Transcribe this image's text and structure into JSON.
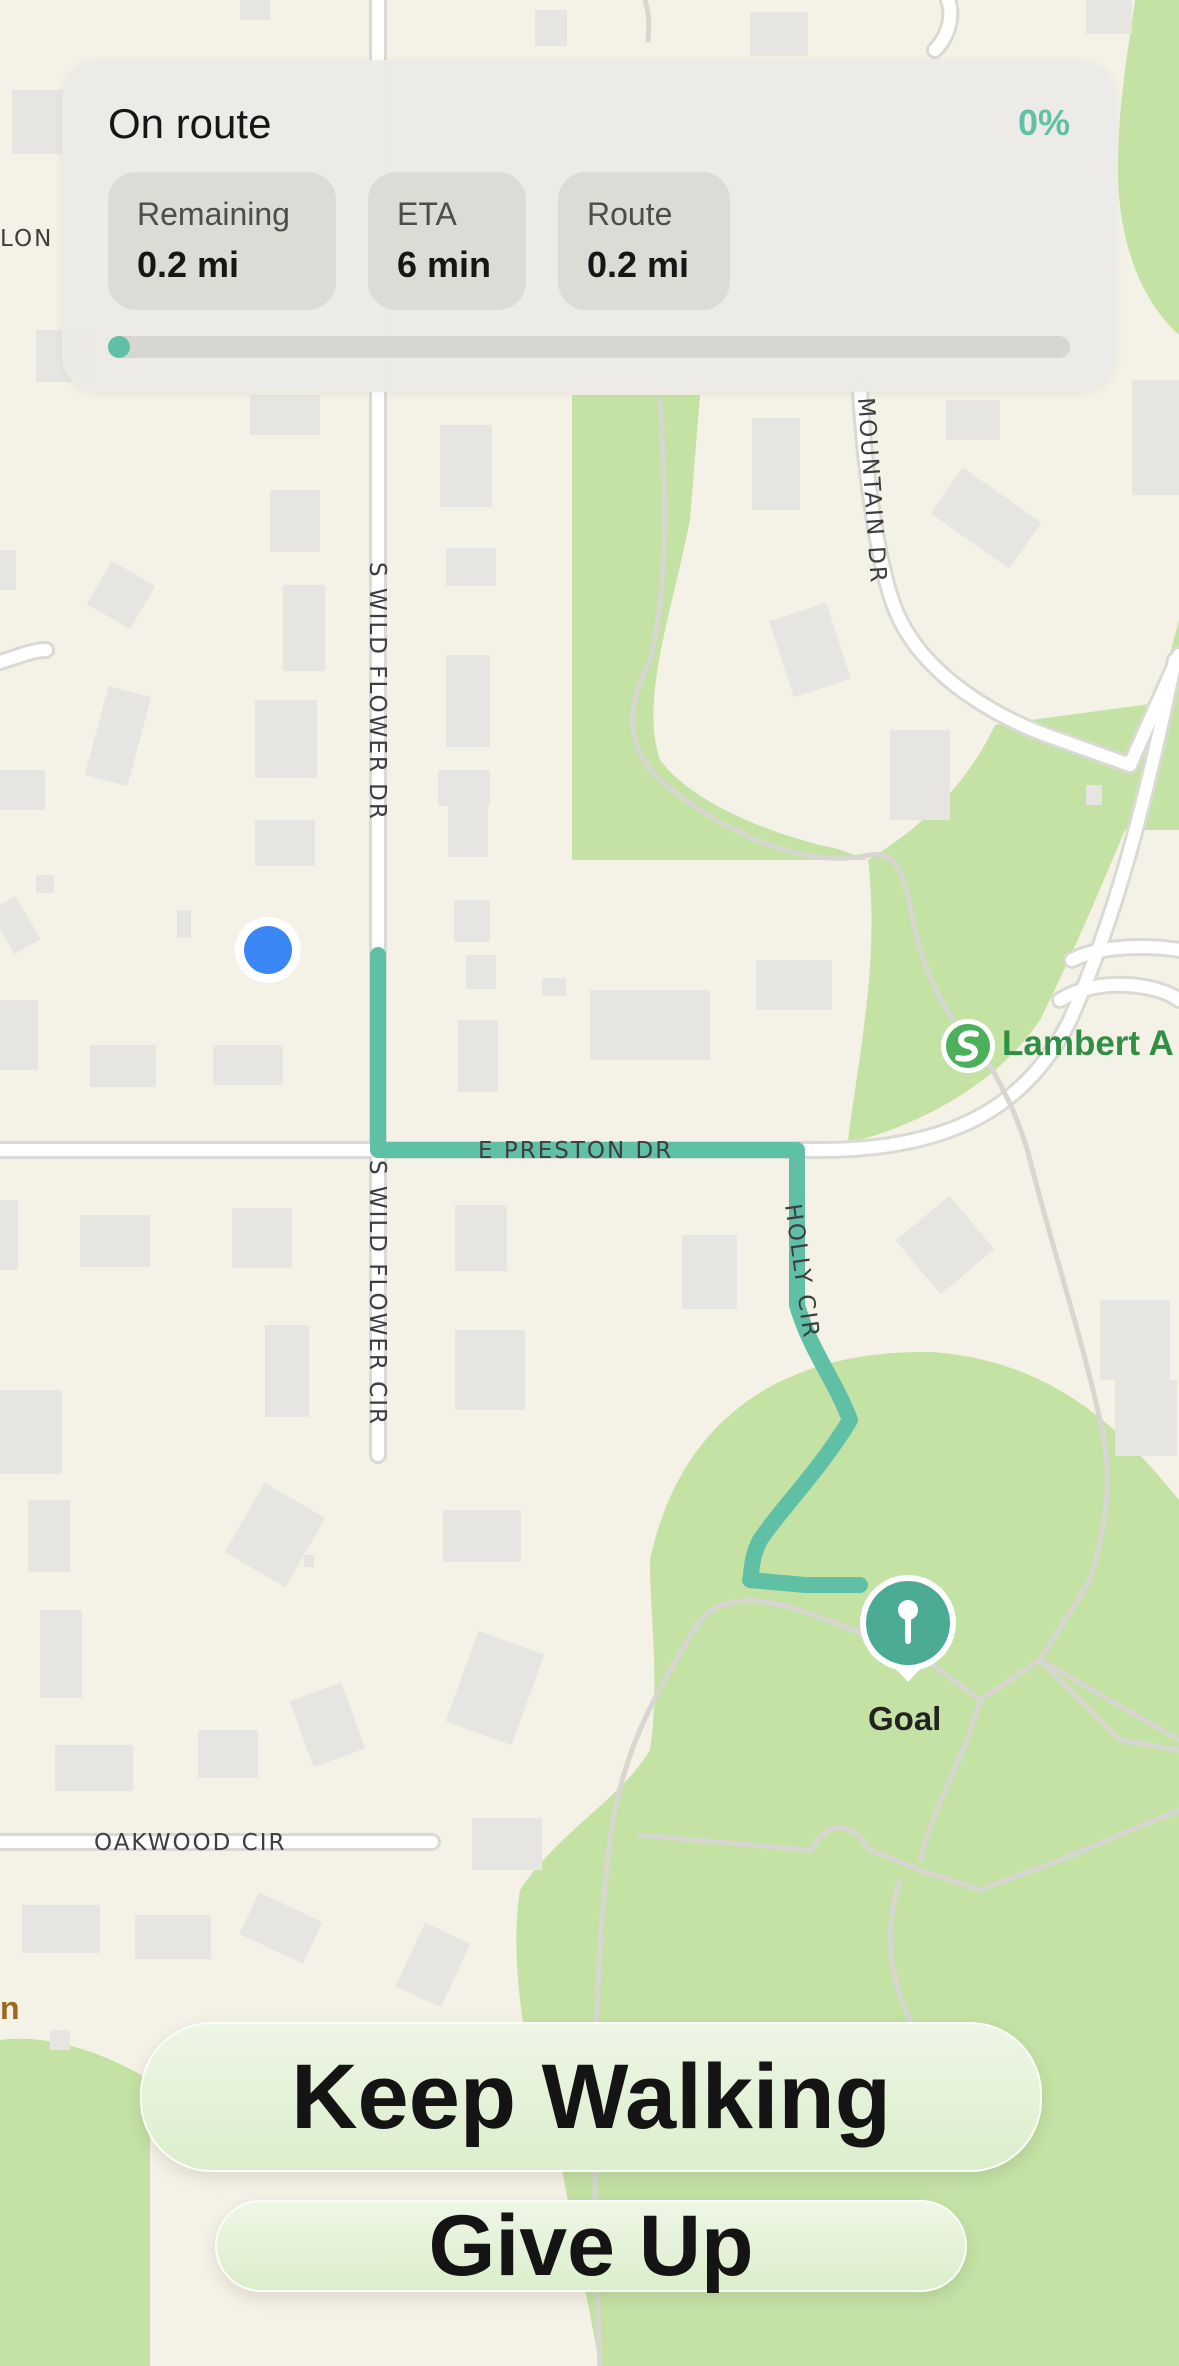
{
  "status": {
    "title": "On route",
    "progress_percent_label": "0%",
    "progress_fraction": 0.0,
    "accent_color": "#5fc0a6",
    "stats": [
      {
        "label": "Remaining",
        "value": "0.2 mi"
      },
      {
        "label": "ETA",
        "value": "6 min"
      },
      {
        "label": "Route",
        "value": "0.2 mi"
      }
    ]
  },
  "map": {
    "road_labels": {
      "s_wild_flower_dr": "S WILD FLOWER DR",
      "s_wild_flower_cir": "S WILD FLOWER CIR",
      "e_preston_dr": "E PRESTON DR",
      "holly_cir": "HOLLY CIR",
      "mountain_dr": "MOUNTAIN DR",
      "oakwood_cir": "OAKWOOD CIR",
      "cut_off_left": "LON"
    },
    "poi": {
      "label": "Lambert A",
      "icon": "park-icon"
    },
    "destination": {
      "label": "Goal",
      "icon": "pin-icon"
    },
    "current_location_icon": "current-location-dot",
    "cut_off_bottom_label": "n",
    "route_color": "#5fc0a6",
    "park_color": "#c5e2a5"
  },
  "actions": {
    "primary": "Keep Walking",
    "secondary": "Give Up"
  }
}
